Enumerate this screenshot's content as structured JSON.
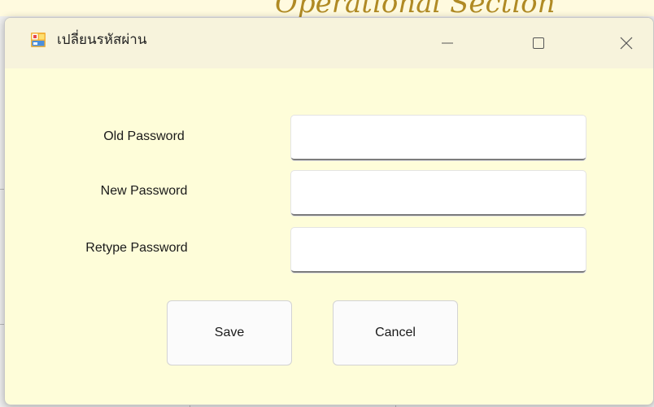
{
  "background": {
    "section_title": "Operational Section"
  },
  "window": {
    "title": "เปลี่ยนรหัสผ่าน",
    "icon": "window-app-icon",
    "controls": {
      "minimize": "minimize-icon",
      "maximize": "maximize-icon",
      "close": "close-icon"
    }
  },
  "form": {
    "old_password": {
      "label": "Old Password",
      "value": ""
    },
    "new_password": {
      "label": "New Password",
      "value": ""
    },
    "retype_password": {
      "label": "Retype Password",
      "value": ""
    }
  },
  "buttons": {
    "save": "Save",
    "cancel": "Cancel"
  },
  "colors": {
    "dialog_background": "#fefdd9",
    "title_bar": "#f7f3dc",
    "background_title": "#b08a24"
  }
}
